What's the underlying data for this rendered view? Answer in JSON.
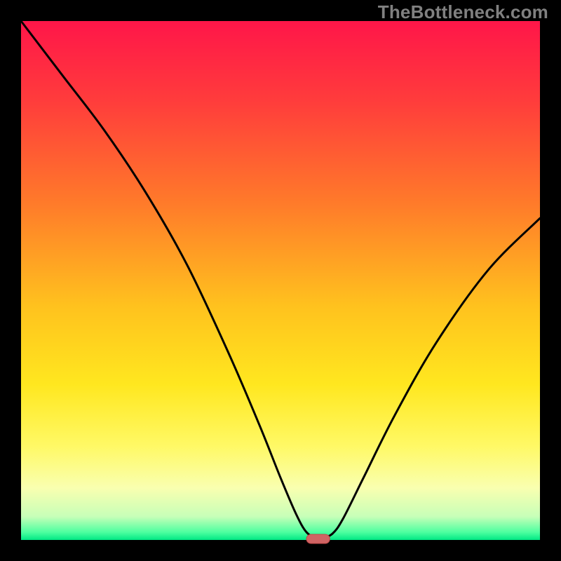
{
  "watermark": "TheBottleneck.com",
  "colors": {
    "frame": "#000000",
    "watermark": "#808080",
    "curve": "#000000",
    "marker_fill": "#d06464",
    "marker_stroke": "#c24848",
    "gradient_stops": [
      {
        "offset": 0.0,
        "color": "#ff1649"
      },
      {
        "offset": 0.15,
        "color": "#ff3b3c"
      },
      {
        "offset": 0.35,
        "color": "#ff7a2a"
      },
      {
        "offset": 0.55,
        "color": "#ffc21e"
      },
      {
        "offset": 0.7,
        "color": "#ffe71f"
      },
      {
        "offset": 0.82,
        "color": "#fff966"
      },
      {
        "offset": 0.9,
        "color": "#f9ffb0"
      },
      {
        "offset": 0.955,
        "color": "#c7ffb8"
      },
      {
        "offset": 0.985,
        "color": "#4dffa0"
      },
      {
        "offset": 1.0,
        "color": "#00e884"
      }
    ]
  },
  "plot": {
    "inner_left": 30,
    "inner_top": 30,
    "inner_width": 740,
    "inner_height": 740
  },
  "chart_data": {
    "type": "line",
    "title": "",
    "xlabel": "",
    "ylabel": "",
    "xlim": [
      0,
      100
    ],
    "ylim": [
      0,
      100
    ],
    "x": [
      0,
      8,
      16,
      24,
      32,
      40,
      46,
      50,
      53,
      55,
      57,
      58,
      60,
      62,
      66,
      72,
      80,
      90,
      100
    ],
    "values": [
      100,
      89.5,
      79,
      67,
      53,
      36,
      22,
      12,
      5,
      1.5,
      0.3,
      0.3,
      1.2,
      4,
      12,
      24,
      38,
      52,
      62
    ],
    "marker": {
      "x_start": 55,
      "x_end": 59.5,
      "y": 0
    },
    "annotations": [],
    "legend": []
  }
}
